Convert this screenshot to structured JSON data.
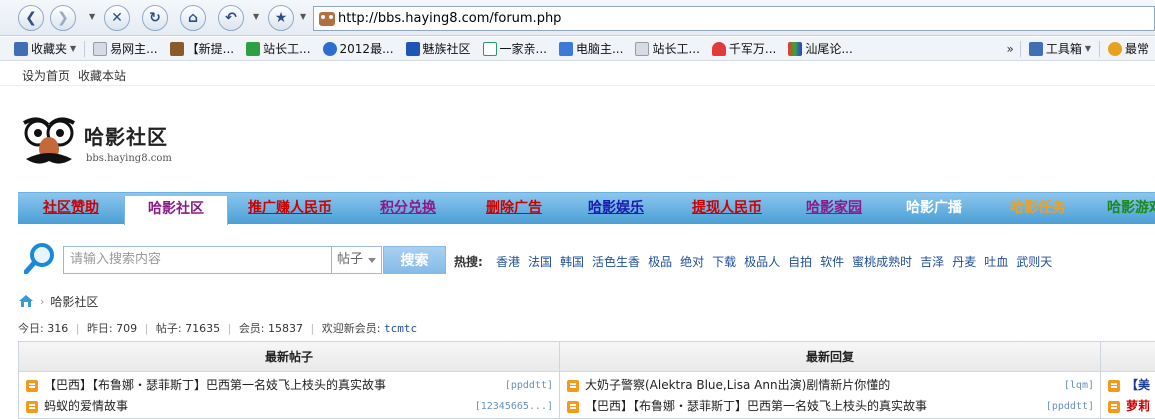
{
  "browser": {
    "url": "http://bbs.haying8.com/forum.php"
  },
  "bookmarks": {
    "favorites_label": "收藏夹",
    "items": [
      "易网主...",
      "【新提...",
      "站长工...",
      "2012最...",
      "魅族社区",
      "一家亲...",
      "电脑主...",
      "站长工...",
      "千军万...",
      "汕尾论..."
    ],
    "more": "»",
    "toolbox_label": "工具箱",
    "last_label": "最常"
  },
  "topbar": {
    "set_home": "设为首页",
    "bookmark_site": "收藏本站"
  },
  "logo": {
    "title": "哈影社区",
    "subtitle": "bbs.haying8.com"
  },
  "nav": {
    "items": [
      {
        "label": "社区赞助",
        "color": "#cc0000"
      },
      {
        "label": "哈影社区",
        "color": "#8a1a8a"
      },
      {
        "label": "推广赚人民币",
        "color": "#cc0000"
      },
      {
        "label": "积分兑换",
        "color": "#8a1a8a"
      },
      {
        "label": "删除广告",
        "color": "#cc0000"
      },
      {
        "label": "哈影娱乐",
        "color": "#1a1ab0"
      },
      {
        "label": "提现人民币",
        "color": "#cc0000"
      },
      {
        "label": "哈影家园",
        "color": "#8a1a8a"
      },
      {
        "label": "哈影广播",
        "color": "#ffffff"
      },
      {
        "label": "哈影任务",
        "color": "#f0a020"
      },
      {
        "label": "哈影游戏",
        "color": "#1a8a1a"
      }
    ]
  },
  "search": {
    "placeholder": "请输入搜索内容",
    "type_selected": "帖子",
    "button_label": "搜索",
    "hot_label": "热搜:",
    "hot_terms": [
      "香港",
      "法国",
      "韩国",
      "活色生香",
      "极品",
      "绝对",
      "下载",
      "极品人",
      "自拍",
      "软件",
      "蜜桃成熟时",
      "吉泽",
      "丹麦",
      "吐血",
      "武则天"
    ]
  },
  "breadcrumb": {
    "current": "哈影社区"
  },
  "stats": {
    "today_label": "今日:",
    "today": "316",
    "yesterday_label": "昨日:",
    "yesterday": "709",
    "posts_label": "帖子:",
    "posts": "71635",
    "members_label": "会员:",
    "members": "15837",
    "welcome_label": "欢迎新会员:",
    "new_member": "tcmtc"
  },
  "panels": [
    {
      "title": "最新帖子",
      "rows": [
        {
          "text": "【巴西】【布鲁娜・瑟菲斯丁】巴西第一名妓飞上枝头的真实故事",
          "author": "[ppddtt]"
        },
        {
          "text": "蚂蚁的爱情故事",
          "author": "[12345665...]"
        }
      ]
    },
    {
      "title": "最新回复",
      "rows": [
        {
          "text": "大奶子警察(Alektra Blue,Lisa Ann出演)剧情新片你懂的",
          "author": "[lqm]"
        },
        {
          "text": "【巴西】【布鲁娜・瑟菲斯丁】巴西第一名妓飞上枝头的真实故事",
          "author": "[ppddtt]"
        }
      ]
    },
    {
      "title": "",
      "rows": [
        {
          "text": "【美",
          "author": ""
        },
        {
          "text": "萝莉",
          "author": ""
        }
      ]
    }
  ]
}
